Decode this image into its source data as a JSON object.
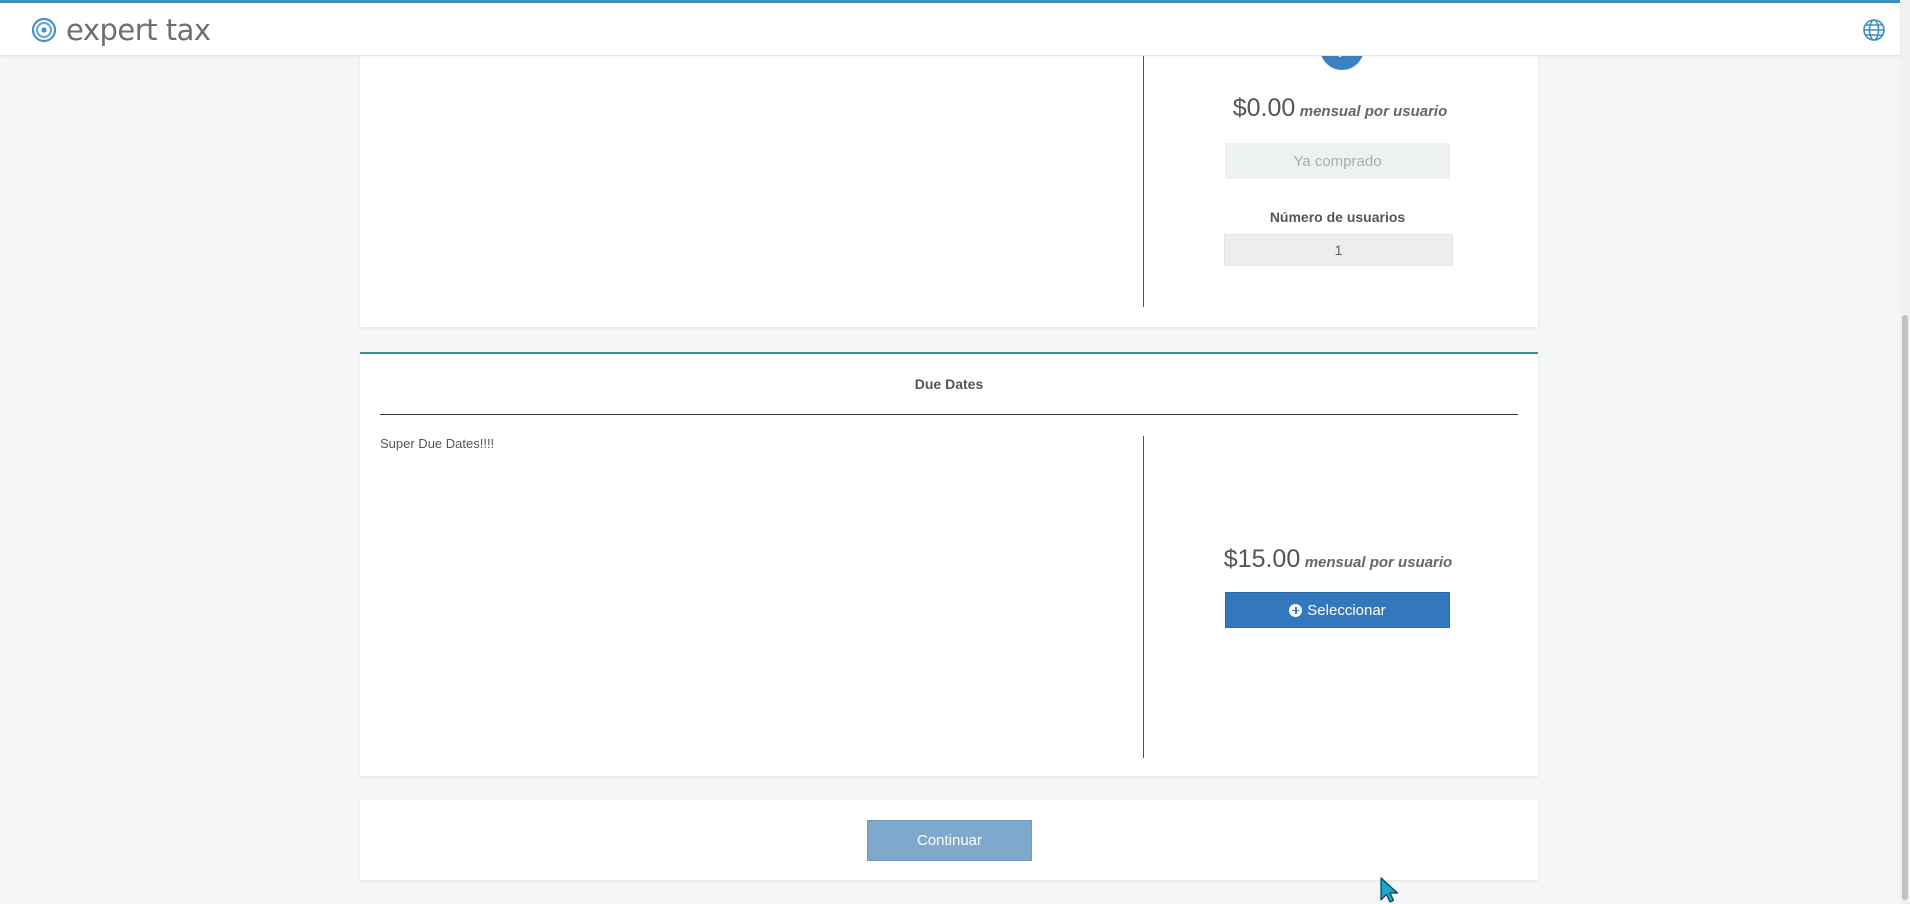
{
  "header": {
    "brand": "expert tax",
    "language_icon": "globe-icon",
    "accent_color": "#3f8fb7"
  },
  "plan_current": {
    "status_icon": "check-circle-icon",
    "price": "$0.00",
    "price_suffix": "mensual por usuario",
    "button_label": "Ya comprado",
    "users_label": "Número de usuarios",
    "users_value": "1"
  },
  "plan_due_dates": {
    "title": "Due Dates",
    "description": "Super Due Dates!!!!",
    "price": "$15.00",
    "price_suffix": "mensual por usuario",
    "button_label": "Seleccionar",
    "button_icon": "plus-circle-icon",
    "button_color": "#3378bc"
  },
  "footer": {
    "continue_label": "Continuar",
    "continue_color": "#7fa8cd"
  }
}
